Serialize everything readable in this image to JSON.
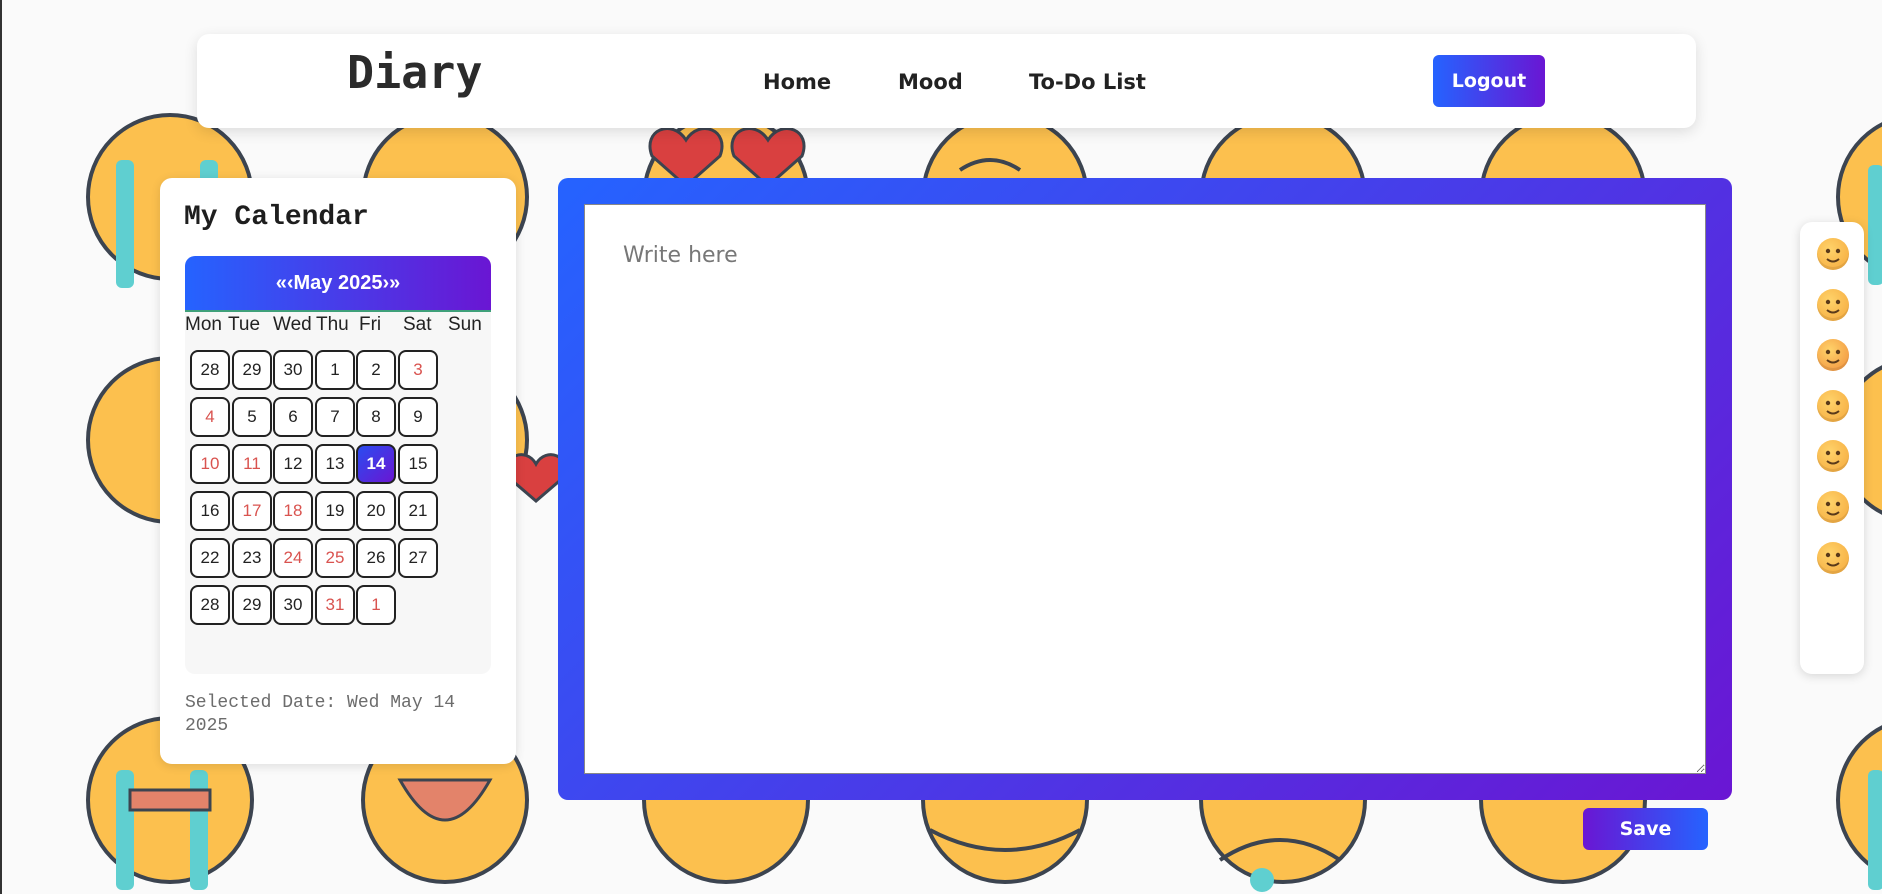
{
  "header": {
    "brand": "Diary",
    "nav": [
      "Home",
      "Mood",
      "To-Do List"
    ],
    "logout_label": "Logout"
  },
  "calendar": {
    "title": "My Calendar",
    "prev_label": "«‹",
    "month_label": "May 2025",
    "next_label": "›»",
    "weekdays": [
      "Mon",
      "Tue",
      "Wed",
      "Thu",
      "Fri",
      "Sat",
      "Sun"
    ],
    "weeks": [
      [
        "28",
        "29",
        "30",
        "1",
        "2",
        "3"
      ],
      [
        "4",
        "5",
        "6",
        "7",
        "8",
        "9"
      ],
      [
        "10",
        "11",
        "12",
        "13",
        "14",
        "15"
      ],
      [
        "16",
        "17",
        "18",
        "19",
        "20",
        "21"
      ],
      [
        "22",
        "23",
        "24",
        "25",
        "26",
        "27"
      ],
      [
        "28",
        "29",
        "30",
        "31",
        "1"
      ]
    ],
    "selected_day": "14",
    "selected_prefix": "Selected Date:",
    "selected_value": "Wed May 14 2025"
  },
  "editor": {
    "placeholder": "Write here",
    "save_label": "Save"
  },
  "moods": [
    {
      "name": "smiling-face-icon",
      "color": "#f4a63a"
    },
    {
      "name": "pleading-face-icon",
      "color": "#f4a63a"
    },
    {
      "name": "angry-face-icon",
      "color": "#f08c3a"
    },
    {
      "name": "pensive-face-icon",
      "color": "#f4a63a"
    },
    {
      "name": "flushed-face-icon",
      "color": "#f4a63a"
    },
    {
      "name": "laughing-tears-face-icon",
      "color": "#f4a63a"
    },
    {
      "name": "screaming-face-icon",
      "color": "#f4a63a"
    }
  ],
  "colors": {
    "accent_start": "#2563ff",
    "accent_end": "#6a16d3",
    "weekend_text": "#d9534f"
  }
}
